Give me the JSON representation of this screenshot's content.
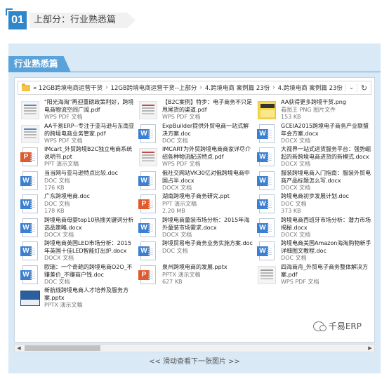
{
  "section": {
    "number": "01",
    "title": "上部分：行业熟悉篇"
  },
  "panel": {
    "title": "行业熟悉篇"
  },
  "address_bar": {
    "crumbs": [
      "« 12GB跨境电商运营干货",
      "12GB跨境电商运营干货--上部分",
      "4.跨境电商 案例篇 23份",
      "4.跨境电商 案例篇 23份"
    ],
    "dropdown_icon": "chevron-down-icon",
    "refresh_icon": "refresh-icon"
  },
  "files": [
    {
      "name": "\"阳光海淘\"再迎重磅政策利好，跨境电商物流空间广阔.pdf",
      "type": "WPS PDF 文档",
      "size": "",
      "icon": "pdf"
    },
    {
      "name": "【B2C案例】特步：电子商务不只是甩尾货的渠道.pdf",
      "type": "WPS PDF 文档",
      "size": "",
      "icon": "pdf"
    },
    {
      "name": "AA获得更多跨境干货.png",
      "type": "看图王 PNG 图片文件",
      "size": "153 KB",
      "icon": "png"
    },
    {
      "name": "AA千易ERP--专注于亚马逊与东南亚的跨境电商业务管家.pdf",
      "type": "WPS PDF 文档",
      "size": "",
      "icon": "pdf"
    },
    {
      "name": "ExpBuilder提供外贸电商一站式解决方案.doc",
      "type": "DOC 文档",
      "size": "",
      "icon": "doc"
    },
    {
      "name": "GCEIA2015跨境电子商务产业联盟年会方案.docx",
      "type": "DOCX 文档",
      "size": "",
      "icon": "doc"
    },
    {
      "name": "IMcart_外贸跨境B2C独立电商系统说明书.ppt",
      "type": "PPT 演示文稿",
      "size": "",
      "icon": "ppt"
    },
    {
      "name": "IMCART为外贸跨境电商商家详尽介绍各种物流配送特点.pdf",
      "type": "WPS PDF 文档",
      "size": "",
      "icon": "pdf"
    },
    {
      "name": "大视界一站式进货服务平台：强势崛起的新跨境电商进货的新模式.docx",
      "type": "DOCX 文档",
      "size": "",
      "icon": "doc"
    },
    {
      "name": "当当网与亚马逊特点比较.doc",
      "type": "DOC 文档",
      "size": "176 KB",
      "icon": "doc"
    },
    {
      "name": "俄社交网站VK30亿对俄跨境电商中国占半.docx",
      "type": "DOCX 文档",
      "size": "",
      "icon": "doc"
    },
    {
      "name": "服装跨境电商入门指南：服装外贸电商产品标题怎么写.docx",
      "type": "DOCX 文档",
      "size": "",
      "icon": "doc"
    },
    {
      "name": "广东跨境电商.doc",
      "type": "DOC 文档",
      "size": "178 KB",
      "icon": "doc"
    },
    {
      "name": "湖南跨境电子商务研究.ppt",
      "type": "PPT 演示文稿",
      "size": "2.20 MB",
      "icon": "ppt"
    },
    {
      "name": "跨境电商初步发展计划.doc",
      "type": "DOC 文档",
      "size": "373 KB",
      "icon": "doc"
    },
    {
      "name": "跨境电商母婴top10热搜关键词分析选品策略.docx",
      "type": "DOCX 文档",
      "size": "",
      "icon": "doc"
    },
    {
      "name": "跨境电商童装市场分析：2015年海外童装市场需求.docx",
      "type": "DOCX 文档",
      "size": "",
      "icon": "doc"
    },
    {
      "name": "跨境电商西班牙市场分析：潜力市场揭秘.docx",
      "type": "DOCX 文档",
      "size": "",
      "icon": "doc"
    },
    {
      "name": "跨境电商英国LED市场分析：2015年英国十佳LED智能灯出炉.docx",
      "type": "DOCX 文档",
      "size": "",
      "icon": "doc"
    },
    {
      "name": "跨境贸易电子商务业务实施方案.doc",
      "type": "DOC 文档",
      "size": "",
      "icon": "doc"
    },
    {
      "name": "跨境电商美国Amazon海淘购物新手详细图文教程.doc",
      "type": "DOC 文档",
      "size": "",
      "icon": "doc"
    },
    {
      "name": "欧瑞：一个奇葩的跨境电商O2O_不赚差价_不赚商户钱.doc",
      "type": "DOC 文档",
      "size": "",
      "icon": "doc"
    },
    {
      "name": "泉州跨境电商的发展.pptx",
      "type": "PPTX 演示文稿",
      "size": "627 KB",
      "icon": "ppt"
    },
    {
      "name": "四海商舟_外贸电子商务整体解决方案.pdf",
      "type": "WPS PDF 文档",
      "size": "",
      "icon": "pdf"
    },
    {
      "name": "新航线跨境电商人才培养及服务方案.pptx",
      "type": "PPTX 演示文稿",
      "size": "",
      "icon": "jpg"
    }
  ],
  "watermark": {
    "text": "千易ERP"
  },
  "next_hint": "<<  滑动查看下一张图片  >>",
  "colors": {
    "accent": "#2f86c9",
    "panel_bg": "#d9e9f6",
    "panel_title": "#5aa3da"
  }
}
